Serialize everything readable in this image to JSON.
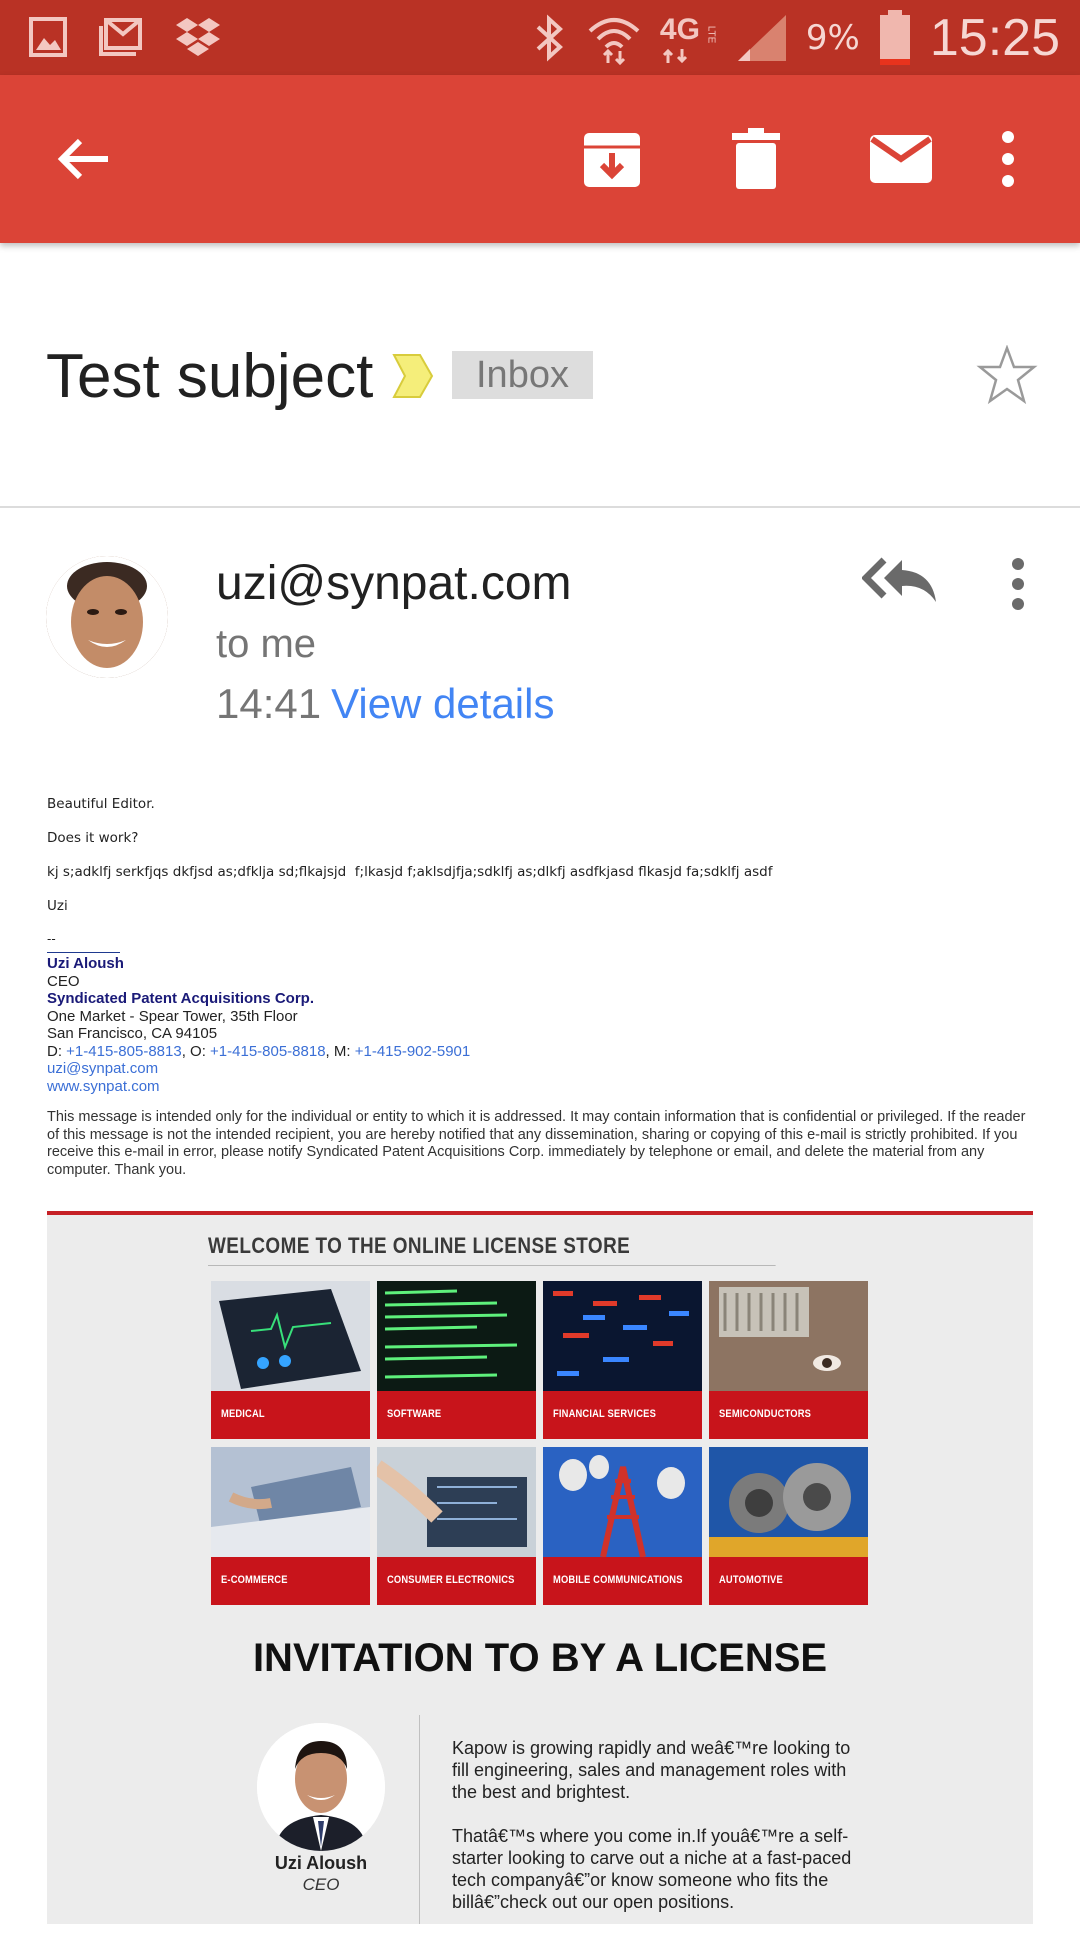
{
  "status_bar": {
    "network": "4G",
    "network_sub": "LTE",
    "battery": "9%",
    "clock": "15:25"
  },
  "colors": {
    "status_bar": "#b93225",
    "app_bar": "#db4437",
    "link": "#4285f4",
    "newsletter_accent": "#c8141b"
  },
  "toolbar": {
    "back": "arrow-back-icon",
    "archive": "archive-icon",
    "delete": "trash-icon",
    "mark_unread": "mail-icon",
    "more": "more-vert-icon"
  },
  "subject": {
    "title": "Test subject",
    "label": "Inbox"
  },
  "sender": {
    "email": "uzi@synpat.com",
    "to": "to me",
    "time": "14:41",
    "details_link": "View details"
  },
  "body": {
    "line1": "Beautiful Editor.",
    "line2": "Does it work?",
    "line3": "kj s;adklfj serkfjqs dkfjsd as;dfklja sd;flkajsjd  f;lkasjd f;aklsdjfja;sdklfj as;dlkfj asdfkjasd flkasjd fa;sdklfj asdf",
    "line4": "Uzi",
    "sig_separator": "--",
    "signature": {
      "name": "Uzi Aloush",
      "title": "CEO",
      "company": "Syndicated Patent Acquisitions Corp.",
      "address1": "One Market - Spear Tower, 35th Floor",
      "address2": "San Francisco, CA 94105",
      "phone_d_label": "D: ",
      "phone_d": "+1-415-805-8813",
      "phone_o_label": ", O: ",
      "phone_o": "+1-415-805-8818",
      "phone_m_label": ", M: ",
      "phone_m": "+1-415-902-5901",
      "email": "uzi@synpat.com",
      "website": "www.synpat.com"
    },
    "disclaimer": "This message is intended only for the individual or entity to which it is addressed. It may contain information that is confidential or privileged. If the reader of this message is not the intended recipient, you are hereby notified that any dissemination, sharing or copying of this e-mail is strictly prohibited. If you receive this e-mail in error, please notify Syndicated Patent Acquisitions Corp. immediately by telephone or email, and delete the material from any computer. Thank you."
  },
  "newsletter": {
    "heading": "WELCOME TO THE ONLINE LICENSE STORE",
    "tiles": [
      {
        "label": "MEDICAL"
      },
      {
        "label": "SOFTWARE"
      },
      {
        "label": "FINANCIAL SERVICES"
      },
      {
        "label": "SEMICONDUCTORS"
      },
      {
        "label": "E-COMMERCE"
      },
      {
        "label": "CONSUMER ELECTRONICS"
      },
      {
        "label": "MOBILE COMMUNICATIONS"
      },
      {
        "label": "AUTOMOTIVE"
      }
    ],
    "title": "INVITATION TO BY A LICENSE",
    "person_name": "Uzi Aloush",
    "person_title": "CEO",
    "para1": "Kapow is growing rapidly and weâ€™re looking to fill engineering, sales and management roles with the best and brightest.",
    "para2": "Thatâ€™s where you come in.If youâ€™re a self-starter looking to carve out a niche at a fast-paced tech companyâ€”or know someone who fits the billâ€”check out our open positions."
  }
}
